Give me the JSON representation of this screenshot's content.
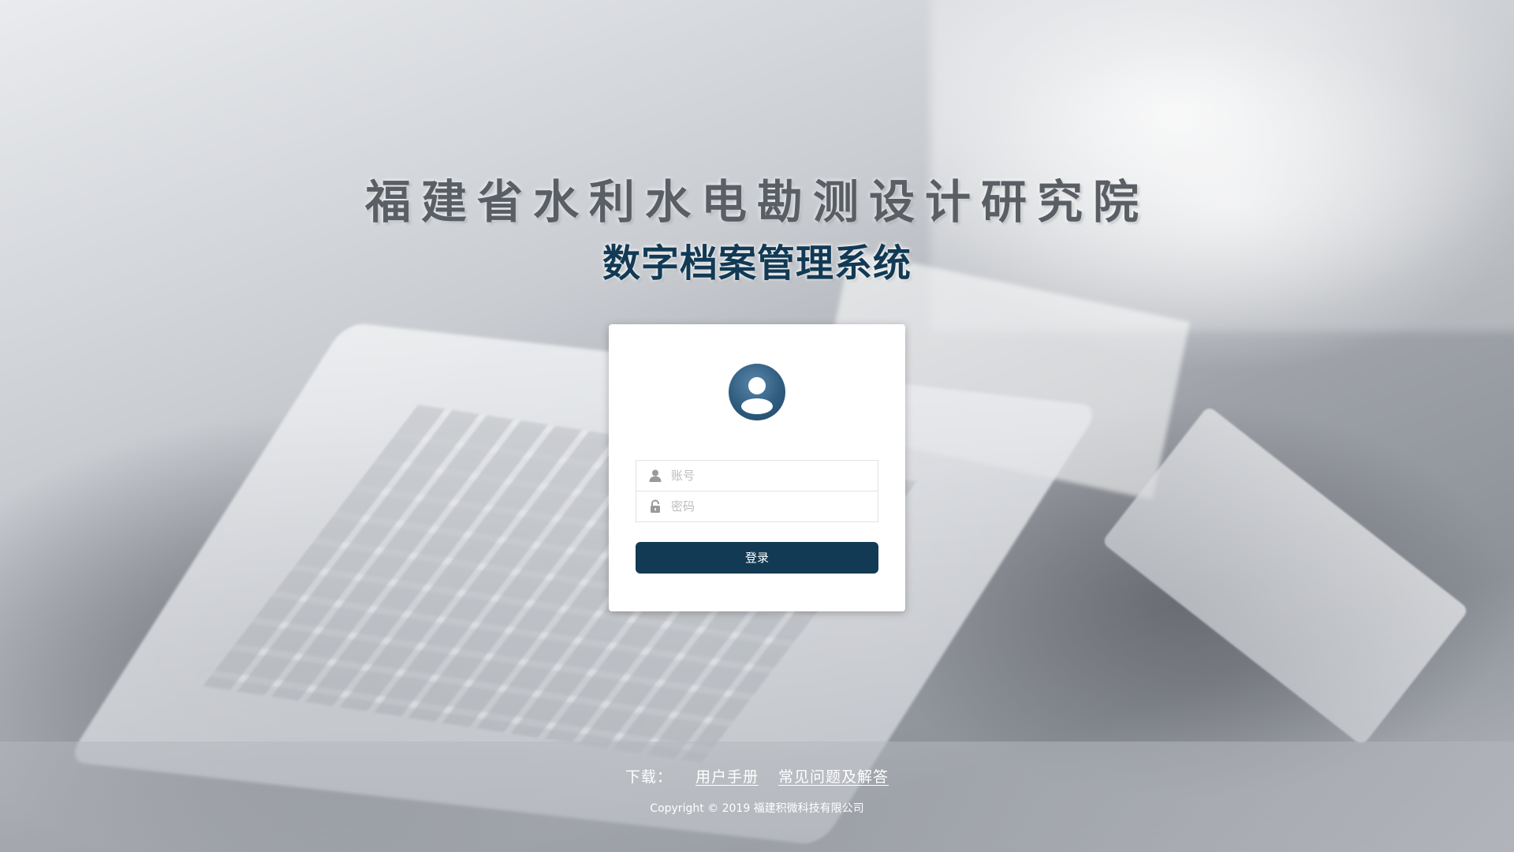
{
  "header": {
    "organization": "福建省水利水电勘测设计研究院",
    "system_name": "数字档案管理系统"
  },
  "login": {
    "avatar_icon": "user-avatar-icon",
    "username_icon": "user-icon",
    "password_icon": "lock-icon",
    "username_value": "",
    "username_placeholder": "账号",
    "password_value": "",
    "password_placeholder": "密码",
    "submit_label": "登录"
  },
  "footer": {
    "download_label": "下载：",
    "links": [
      "用户手册",
      "常见问题及解答"
    ],
    "copyright": "Copyright © 2019 福建积微科技有限公司"
  },
  "colors": {
    "primary": "#123a55",
    "title_gray": "#5a5f66",
    "avatar_blue": "#2f5d80"
  }
}
